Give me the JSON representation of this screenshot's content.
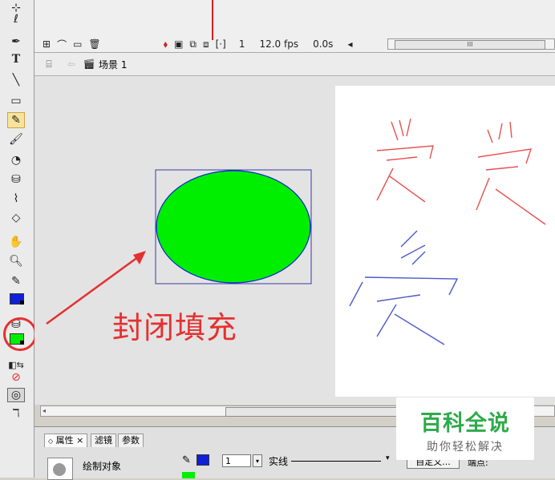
{
  "timeline": {
    "frame_number": "1",
    "fps": "12.0 fps",
    "time": "0.0s",
    "scroll_grip": "III"
  },
  "breadcrumb": {
    "scene_label": "场景 1"
  },
  "annotation": {
    "caption": "封闭填充"
  },
  "properties": {
    "tabs": [
      {
        "label": "属性"
      },
      {
        "label": "滤镜"
      },
      {
        "label": "参数"
      }
    ],
    "tab_close_glyph": "×",
    "object_name": "绘制对象",
    "stroke_height": "1",
    "stroke_style": "实线",
    "custom_button": "自定义...",
    "cap_label": "端点:"
  },
  "colors": {
    "stroke": "#1020d8",
    "fill": "#00ee00",
    "annotation": "#e53030",
    "watermark_green": "#2eaa4a"
  },
  "watermark": {
    "title": "百科全说",
    "subtitle": "助你轻松解决"
  }
}
